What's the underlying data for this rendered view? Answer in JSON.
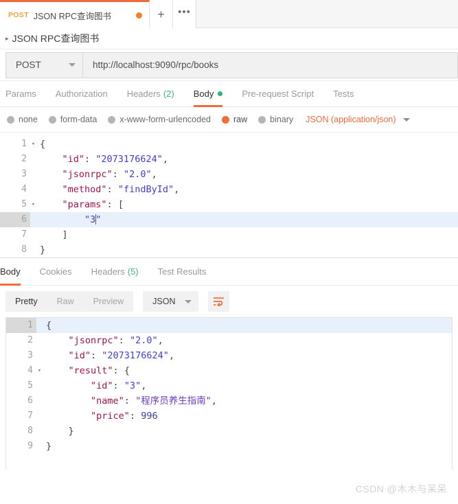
{
  "tabbar": {
    "request_tab": {
      "method": "POST",
      "name": "JSON RPC查询图书",
      "dirty": "●"
    },
    "new_tab_label": "+",
    "more_label": "•••"
  },
  "breadcrumb": {
    "arrow": "▸",
    "text": "JSON RPC查询图书"
  },
  "url_row": {
    "method": "POST",
    "url": "http://localhost:9090/rpc/books"
  },
  "request_tabs": [
    {
      "label": "Params",
      "count": "",
      "active": false
    },
    {
      "label": "Authorization",
      "count": "",
      "active": false
    },
    {
      "label": "Headers",
      "count": "(2)",
      "active": false
    },
    {
      "label": "Body",
      "count": "",
      "active": true
    },
    {
      "label": "Pre-request Script",
      "count": "",
      "active": false
    },
    {
      "label": "Tests",
      "count": "",
      "active": false
    }
  ],
  "body_types": [
    {
      "label": "none",
      "selected": false
    },
    {
      "label": "form-data",
      "selected": false
    },
    {
      "label": "x-www-form-urlencoded",
      "selected": false
    },
    {
      "label": "raw",
      "selected": true
    },
    {
      "label": "binary",
      "selected": false
    }
  ],
  "content_type": {
    "label": "JSON (application/json)"
  },
  "request_body": {
    "lines": [
      {
        "no": "1",
        "fold": "▾",
        "highlight": false,
        "tokens": [
          {
            "t": "{",
            "c": "p"
          }
        ]
      },
      {
        "no": "2",
        "fold": "",
        "highlight": false,
        "tokens": [
          {
            "t": "    \"id\"",
            "c": "k"
          },
          {
            "t": ": ",
            "c": "p"
          },
          {
            "t": "\"2073176624\"",
            "c": "s"
          },
          {
            "t": ",",
            "c": "p"
          }
        ]
      },
      {
        "no": "3",
        "fold": "",
        "highlight": false,
        "tokens": [
          {
            "t": "    \"jsonrpc\"",
            "c": "k"
          },
          {
            "t": ": ",
            "c": "p"
          },
          {
            "t": "\"2.0\"",
            "c": "s"
          },
          {
            "t": ",",
            "c": "p"
          }
        ]
      },
      {
        "no": "4",
        "fold": "",
        "highlight": false,
        "tokens": [
          {
            "t": "    \"method\"",
            "c": "k"
          },
          {
            "t": ": ",
            "c": "p"
          },
          {
            "t": "\"findById\"",
            "c": "s"
          },
          {
            "t": ",",
            "c": "p"
          }
        ]
      },
      {
        "no": "5",
        "fold": "▾",
        "highlight": false,
        "tokens": [
          {
            "t": "    \"params\"",
            "c": "k"
          },
          {
            "t": ": ",
            "c": "p"
          },
          {
            "t": "[",
            "c": "p"
          }
        ]
      },
      {
        "no": "6",
        "fold": "",
        "highlight": true,
        "cursor": true,
        "tokens": [
          {
            "t": "        \"3",
            "c": "s"
          },
          {
            "t": "\"",
            "c": "s",
            "after_cursor": true
          }
        ]
      },
      {
        "no": "7",
        "fold": "",
        "highlight": false,
        "tokens": [
          {
            "t": "    ]",
            "c": "p"
          }
        ]
      },
      {
        "no": "8",
        "fold": "",
        "highlight": false,
        "tokens": [
          {
            "t": "}",
            "c": "p"
          }
        ]
      }
    ]
  },
  "response_tabs": [
    {
      "label": "Body",
      "count": "",
      "active": true
    },
    {
      "label": "Cookies",
      "count": "",
      "active": false
    },
    {
      "label": "Headers",
      "count": "(5)",
      "active": false
    },
    {
      "label": "Test Results",
      "count": "",
      "active": false
    }
  ],
  "response_toolbar": {
    "views": [
      {
        "label": "Pretty",
        "active": true
      },
      {
        "label": "Raw",
        "active": false
      },
      {
        "label": "Preview",
        "active": false
      }
    ],
    "format": "JSON",
    "wrap_icon": "word-wrap"
  },
  "response_body": {
    "lines": [
      {
        "no": "1",
        "fold": "▾",
        "highlight": true,
        "tokens": [
          {
            "t": "{",
            "c": "p"
          }
        ]
      },
      {
        "no": "2",
        "fold": "",
        "highlight": false,
        "tokens": [
          {
            "t": "    \"jsonrpc\"",
            "c": "k"
          },
          {
            "t": ": ",
            "c": "p"
          },
          {
            "t": "\"2.0\"",
            "c": "s"
          },
          {
            "t": ",",
            "c": "p"
          }
        ]
      },
      {
        "no": "3",
        "fold": "",
        "highlight": false,
        "tokens": [
          {
            "t": "    \"id\"",
            "c": "k"
          },
          {
            "t": ": ",
            "c": "p"
          },
          {
            "t": "\"2073176624\"",
            "c": "s"
          },
          {
            "t": ",",
            "c": "p"
          }
        ]
      },
      {
        "no": "4",
        "fold": "▾",
        "highlight": false,
        "tokens": [
          {
            "t": "    \"result\"",
            "c": "k"
          },
          {
            "t": ": ",
            "c": "p"
          },
          {
            "t": "{",
            "c": "p"
          }
        ]
      },
      {
        "no": "5",
        "fold": "",
        "highlight": false,
        "tokens": [
          {
            "t": "        \"id\"",
            "c": "k"
          },
          {
            "t": ": ",
            "c": "p"
          },
          {
            "t": "\"3\"",
            "c": "s"
          },
          {
            "t": ",",
            "c": "p"
          }
        ]
      },
      {
        "no": "6",
        "fold": "",
        "highlight": false,
        "tokens": [
          {
            "t": "        \"name\"",
            "c": "k"
          },
          {
            "t": ": ",
            "c": "p"
          },
          {
            "t": "\"程序员养生指南\"",
            "c": "cn"
          },
          {
            "t": ",",
            "c": "p"
          }
        ]
      },
      {
        "no": "7",
        "fold": "",
        "highlight": false,
        "tokens": [
          {
            "t": "        \"price\"",
            "c": "k"
          },
          {
            "t": ": ",
            "c": "p"
          },
          {
            "t": "996",
            "c": "n"
          }
        ]
      },
      {
        "no": "8",
        "fold": "",
        "highlight": false,
        "tokens": [
          {
            "t": "    }",
            "c": "p"
          }
        ]
      },
      {
        "no": "9",
        "fold": "",
        "highlight": false,
        "tokens": [
          {
            "t": "}",
            "c": "p"
          }
        ]
      }
    ]
  },
  "watermark": {
    "text": "CSDN @木木与呆呆"
  },
  "colors": {
    "accent": "#f26b3a",
    "method_post": "#e8a33d",
    "green": "#2ab673",
    "key": "#a3134d",
    "string": "#3f3fd0"
  }
}
